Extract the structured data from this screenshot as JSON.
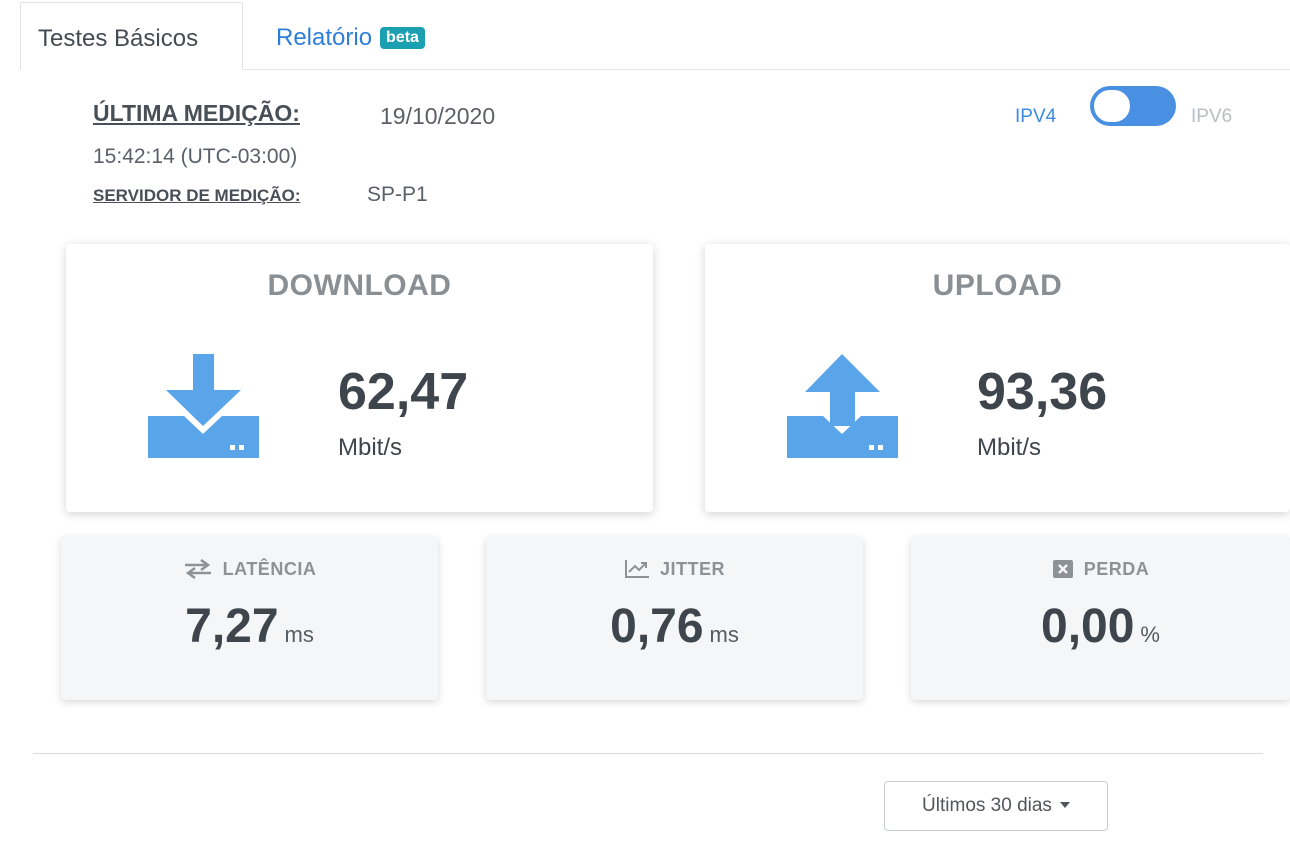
{
  "tabs": {
    "basic": "Testes Básicos",
    "report": "Relatório",
    "report_badge": "beta"
  },
  "measurement": {
    "last_label": "ÚLTIMA MEDIÇÃO:",
    "date": "19/10/2020",
    "time": "15:42:14 (UTC-03:00)",
    "server_label": "SERVIDOR DE MEDIÇÃO:",
    "server_value": "SP-P1"
  },
  "ip_toggle": {
    "left_label": "IPV4",
    "right_label": "IPV6",
    "selected": "IPV4"
  },
  "download": {
    "title": "DOWNLOAD",
    "value": "62,47",
    "unit": "Mbit/s",
    "icon": "download-icon"
  },
  "upload": {
    "title": "UPLOAD",
    "value": "93,36",
    "unit": "Mbit/s",
    "icon": "upload-icon"
  },
  "latency": {
    "title": "LATÊNCIA",
    "value": "7,27",
    "unit": "ms",
    "icon": "swap-arrows-icon"
  },
  "jitter": {
    "title": "JITTER",
    "value": "0,76",
    "unit": "ms",
    "icon": "line-chart-icon"
  },
  "loss": {
    "title": "PERDA",
    "value": "0,00",
    "unit": "%",
    "icon": "x-square-icon"
  },
  "period_select": {
    "label": "Últimos 30 dias"
  },
  "colors": {
    "accent_blue": "#4a90e2",
    "badge_teal": "#1aa0b0",
    "icon_blue": "#5aa4ea"
  }
}
